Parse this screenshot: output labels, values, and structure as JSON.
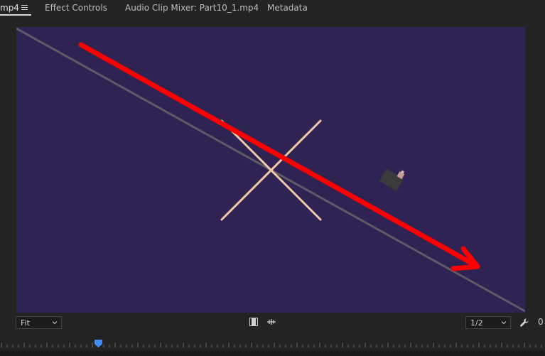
{
  "tabs": [
    {
      "label": "mp4",
      "active": true
    },
    {
      "label": "Effect Controls",
      "active": false
    },
    {
      "label": "Audio Clip Mixer: Part10_1.mp4",
      "active": false
    },
    {
      "label": "Metadata",
      "active": false
    }
  ],
  "viewer": {
    "background_color": "#2e2352",
    "arrow_color": "#ff0000",
    "line_color": "#5e5a66",
    "cross_color": "#f2c9a8"
  },
  "controls": {
    "zoom_select_value": "Fit",
    "resolution_select_value": "1/2",
    "timecode_partial": "0"
  },
  "icons": {
    "panel_menu": "hamburger-icon",
    "zoom_dropdown": "chevron-down-icon",
    "film": "film-strip-icon",
    "audio": "audio-waveform-icon",
    "resolution_dropdown": "chevron-down-icon",
    "settings": "wrench-icon",
    "playhead": "playhead-icon"
  }
}
